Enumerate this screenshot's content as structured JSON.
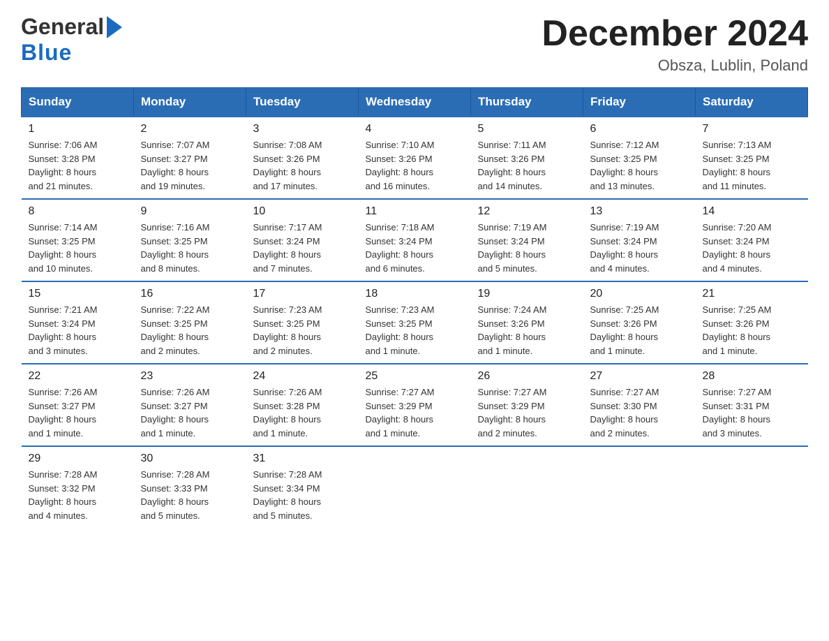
{
  "header": {
    "logo_general": "General",
    "logo_blue": "Blue",
    "month_title": "December 2024",
    "location": "Obsza, Lublin, Poland"
  },
  "days_of_week": [
    "Sunday",
    "Monday",
    "Tuesday",
    "Wednesday",
    "Thursday",
    "Friday",
    "Saturday"
  ],
  "weeks": [
    [
      {
        "day": "1",
        "sunrise": "7:06 AM",
        "sunset": "3:28 PM",
        "daylight": "8 hours and 21 minutes."
      },
      {
        "day": "2",
        "sunrise": "7:07 AM",
        "sunset": "3:27 PM",
        "daylight": "8 hours and 19 minutes."
      },
      {
        "day": "3",
        "sunrise": "7:08 AM",
        "sunset": "3:26 PM",
        "daylight": "8 hours and 17 minutes."
      },
      {
        "day": "4",
        "sunrise": "7:10 AM",
        "sunset": "3:26 PM",
        "daylight": "8 hours and 16 minutes."
      },
      {
        "day": "5",
        "sunrise": "7:11 AM",
        "sunset": "3:26 PM",
        "daylight": "8 hours and 14 minutes."
      },
      {
        "day": "6",
        "sunrise": "7:12 AM",
        "sunset": "3:25 PM",
        "daylight": "8 hours and 13 minutes."
      },
      {
        "day": "7",
        "sunrise": "7:13 AM",
        "sunset": "3:25 PM",
        "daylight": "8 hours and 11 minutes."
      }
    ],
    [
      {
        "day": "8",
        "sunrise": "7:14 AM",
        "sunset": "3:25 PM",
        "daylight": "8 hours and 10 minutes."
      },
      {
        "day": "9",
        "sunrise": "7:16 AM",
        "sunset": "3:25 PM",
        "daylight": "8 hours and 8 minutes."
      },
      {
        "day": "10",
        "sunrise": "7:17 AM",
        "sunset": "3:24 PM",
        "daylight": "8 hours and 7 minutes."
      },
      {
        "day": "11",
        "sunrise": "7:18 AM",
        "sunset": "3:24 PM",
        "daylight": "8 hours and 6 minutes."
      },
      {
        "day": "12",
        "sunrise": "7:19 AM",
        "sunset": "3:24 PM",
        "daylight": "8 hours and 5 minutes."
      },
      {
        "day": "13",
        "sunrise": "7:19 AM",
        "sunset": "3:24 PM",
        "daylight": "8 hours and 4 minutes."
      },
      {
        "day": "14",
        "sunrise": "7:20 AM",
        "sunset": "3:24 PM",
        "daylight": "8 hours and 4 minutes."
      }
    ],
    [
      {
        "day": "15",
        "sunrise": "7:21 AM",
        "sunset": "3:24 PM",
        "daylight": "8 hours and 3 minutes."
      },
      {
        "day": "16",
        "sunrise": "7:22 AM",
        "sunset": "3:25 PM",
        "daylight": "8 hours and 2 minutes."
      },
      {
        "day": "17",
        "sunrise": "7:23 AM",
        "sunset": "3:25 PM",
        "daylight": "8 hours and 2 minutes."
      },
      {
        "day": "18",
        "sunrise": "7:23 AM",
        "sunset": "3:25 PM",
        "daylight": "8 hours and 1 minute."
      },
      {
        "day": "19",
        "sunrise": "7:24 AM",
        "sunset": "3:26 PM",
        "daylight": "8 hours and 1 minute."
      },
      {
        "day": "20",
        "sunrise": "7:25 AM",
        "sunset": "3:26 PM",
        "daylight": "8 hours and 1 minute."
      },
      {
        "day": "21",
        "sunrise": "7:25 AM",
        "sunset": "3:26 PM",
        "daylight": "8 hours and 1 minute."
      }
    ],
    [
      {
        "day": "22",
        "sunrise": "7:26 AM",
        "sunset": "3:27 PM",
        "daylight": "8 hours and 1 minute."
      },
      {
        "day": "23",
        "sunrise": "7:26 AM",
        "sunset": "3:27 PM",
        "daylight": "8 hours and 1 minute."
      },
      {
        "day": "24",
        "sunrise": "7:26 AM",
        "sunset": "3:28 PM",
        "daylight": "8 hours and 1 minute."
      },
      {
        "day": "25",
        "sunrise": "7:27 AM",
        "sunset": "3:29 PM",
        "daylight": "8 hours and 1 minute."
      },
      {
        "day": "26",
        "sunrise": "7:27 AM",
        "sunset": "3:29 PM",
        "daylight": "8 hours and 2 minutes."
      },
      {
        "day": "27",
        "sunrise": "7:27 AM",
        "sunset": "3:30 PM",
        "daylight": "8 hours and 2 minutes."
      },
      {
        "day": "28",
        "sunrise": "7:27 AM",
        "sunset": "3:31 PM",
        "daylight": "8 hours and 3 minutes."
      }
    ],
    [
      {
        "day": "29",
        "sunrise": "7:28 AM",
        "sunset": "3:32 PM",
        "daylight": "8 hours and 4 minutes."
      },
      {
        "day": "30",
        "sunrise": "7:28 AM",
        "sunset": "3:33 PM",
        "daylight": "8 hours and 5 minutes."
      },
      {
        "day": "31",
        "sunrise": "7:28 AM",
        "sunset": "3:34 PM",
        "daylight": "8 hours and 5 minutes."
      },
      null,
      null,
      null,
      null
    ]
  ],
  "labels": {
    "sunrise": "Sunrise:",
    "sunset": "Sunset:",
    "daylight": "Daylight:"
  }
}
